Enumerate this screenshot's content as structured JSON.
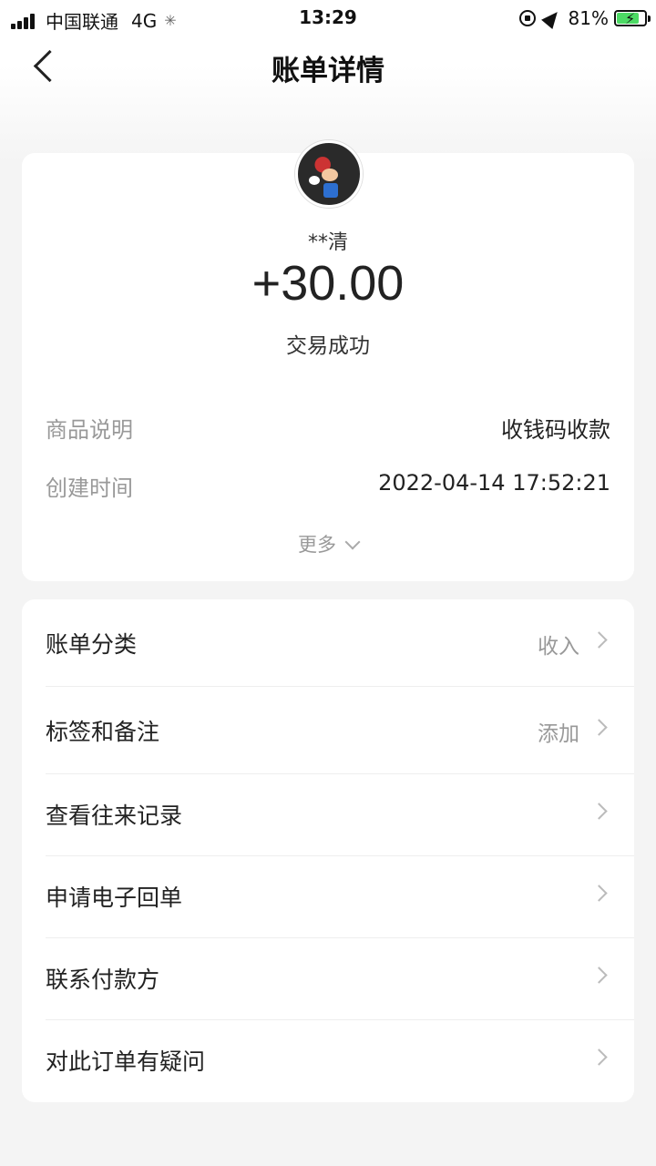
{
  "status_bar": {
    "carrier": "中国联通",
    "network": "4G",
    "time": "13:29",
    "battery": "81%"
  },
  "nav": {
    "title": "账单详情"
  },
  "transaction": {
    "payer": "**清",
    "amount": "+30.00",
    "status": "交易成功",
    "details": [
      {
        "key": "商品说明",
        "value": "收钱码收款"
      },
      {
        "key": "创建时间",
        "value": "2022-04-14 17:52:21"
      }
    ],
    "more_label": "更多"
  },
  "actions": [
    {
      "label": "账单分类",
      "value": "收入"
    },
    {
      "label": "标签和备注",
      "value": "添加"
    },
    {
      "label": "查看往来记录",
      "value": ""
    },
    {
      "label": "申请电子回单",
      "value": ""
    },
    {
      "label": "联系付款方",
      "value": ""
    },
    {
      "label": "对此订单有疑问",
      "value": ""
    }
  ],
  "colors": {
    "background": "#f4f4f4",
    "card": "#ffffff",
    "battery_fill": "#4cd964",
    "muted_text": "#999999"
  }
}
